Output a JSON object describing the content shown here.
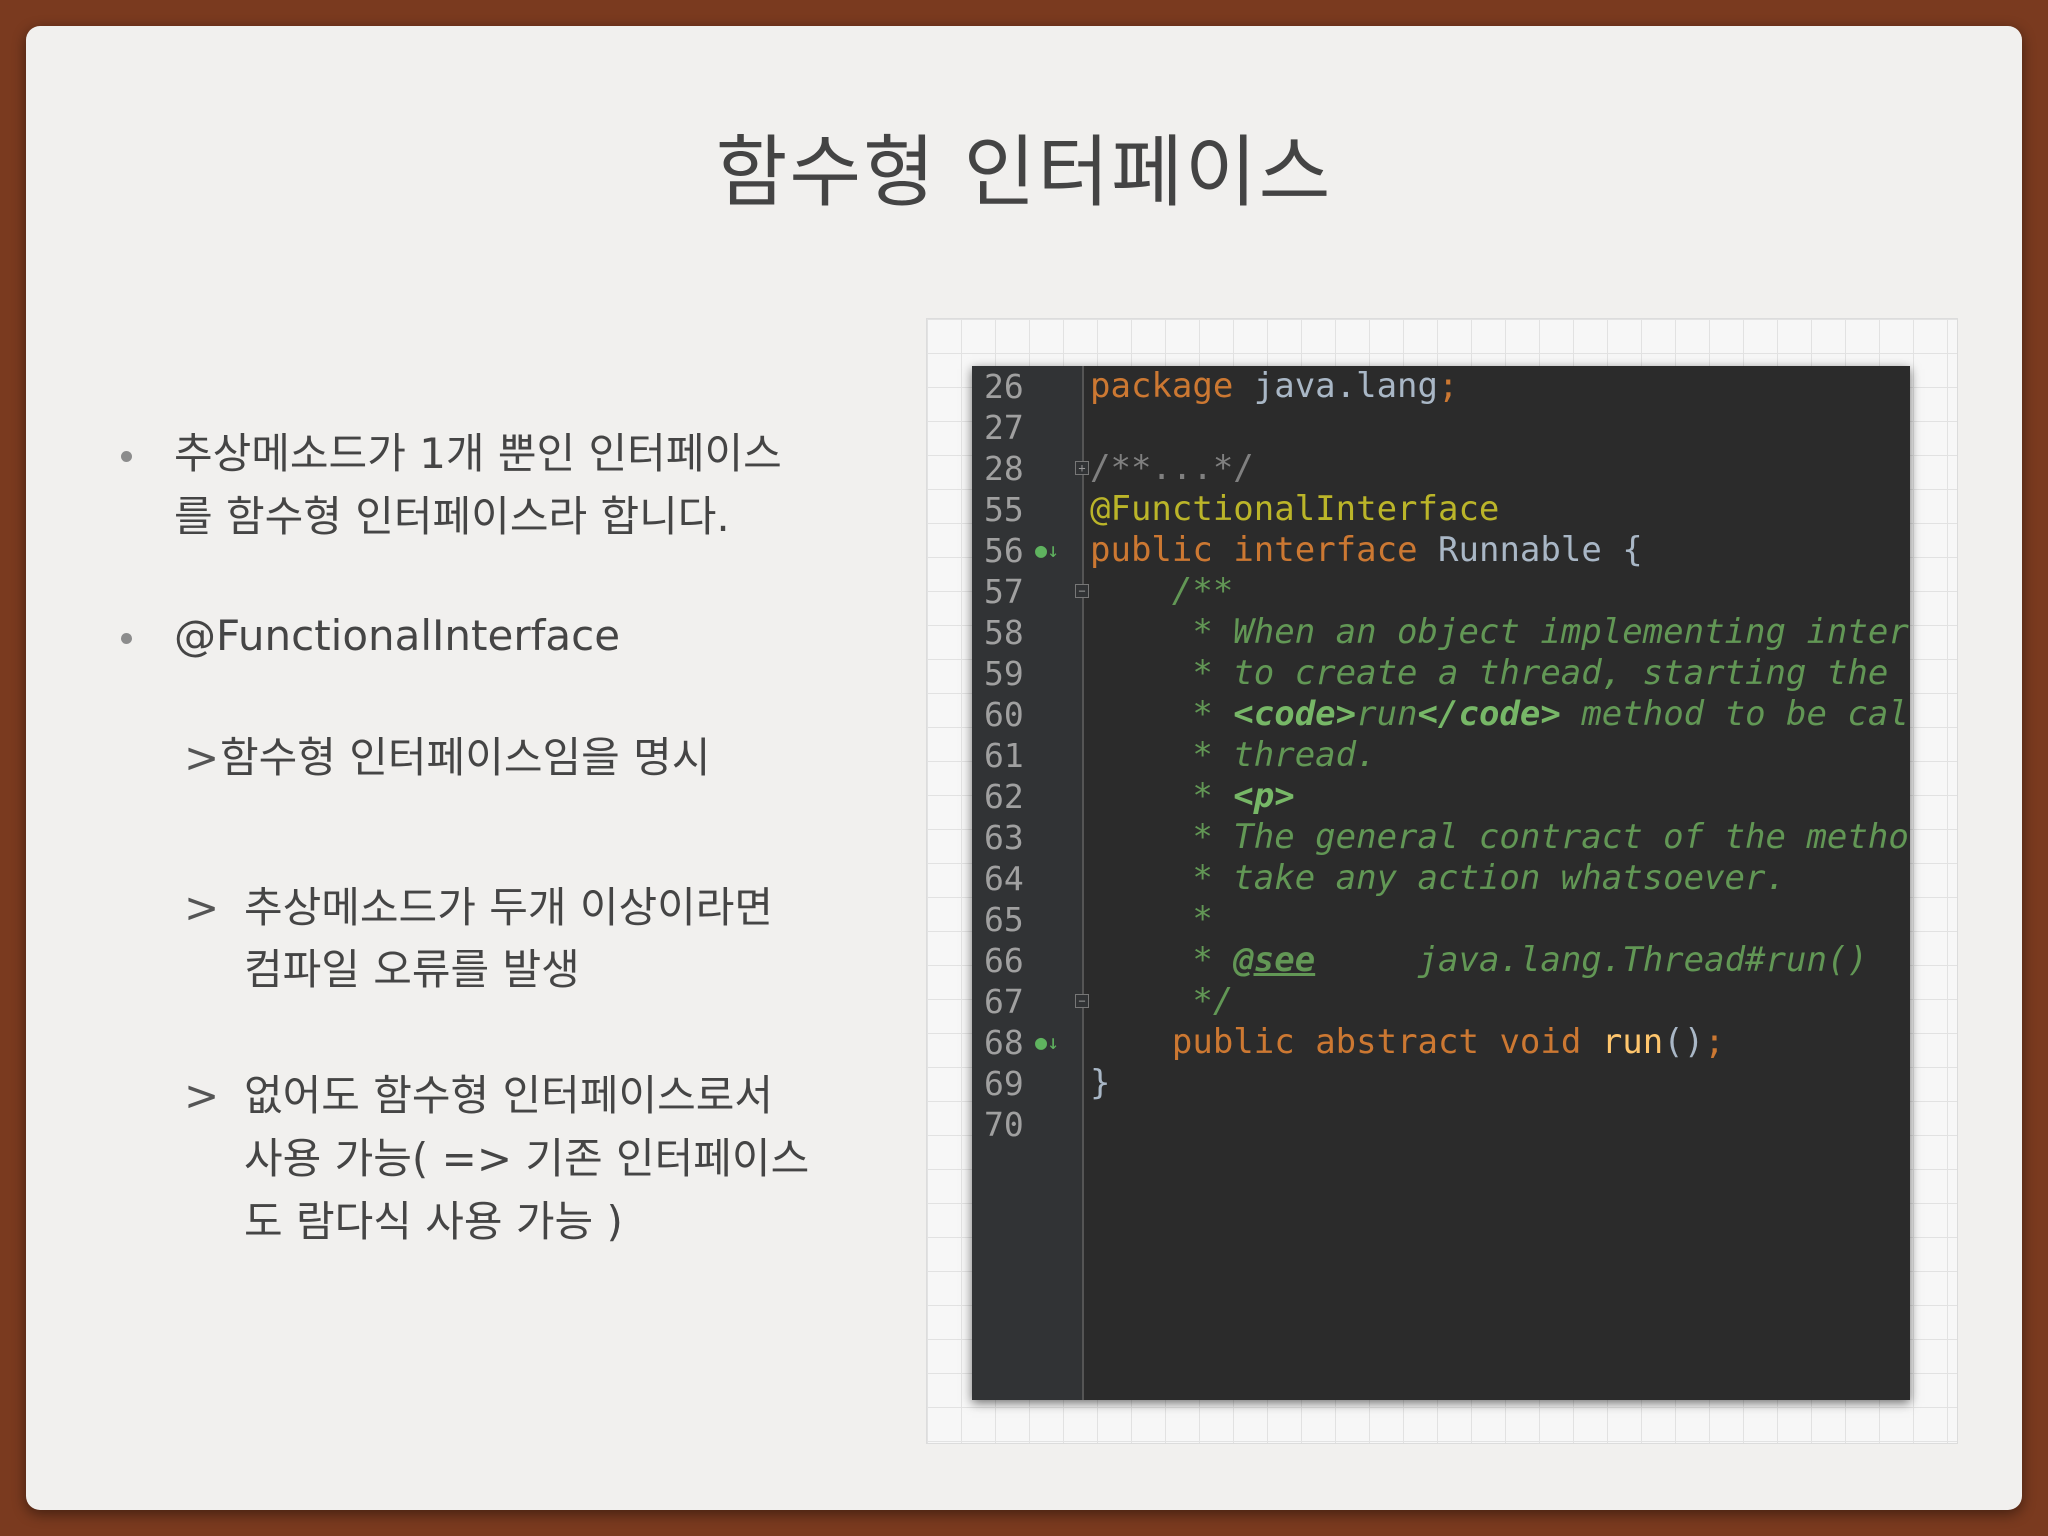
{
  "title": "함수형 인터페이스",
  "bullets": [
    {
      "lines": [
        "추상메소드가 1개 뿐인 인터페이스",
        "를 함수형 인터페이스라 합니다."
      ]
    },
    {
      "lines": [
        "@FunctionalInterface"
      ]
    }
  ],
  "sub_items": [
    {
      "marker": ">",
      "lines": [
        "함수형 인터페이스임을 명시"
      ]
    },
    {
      "marker": ">",
      "lines": [
        "추상메소드가 두개 이상이라면",
        "컴파일 오류를 발생"
      ]
    },
    {
      "marker": ">",
      "lines": [
        "없어도 함수형 인터페이스로서",
        "사용 가능( => 기존 인터페이스",
        "도 람다식 사용 가능 )"
      ]
    }
  ],
  "code": {
    "line_numbers": [
      "26",
      "27",
      "28",
      "55",
      "56",
      "57",
      "58",
      "59",
      "60",
      "61",
      "62",
      "63",
      "64",
      "65",
      "66",
      "67",
      "68",
      "69",
      "70"
    ],
    "lines": {
      "l26": {
        "kw": "package",
        "rest": " java.lang",
        "semi": ";"
      },
      "l28": "/**...*/",
      "l55": "@FunctionalInterface",
      "l56": {
        "kw1": "public",
        "kw2": "interface",
        "name": "Runnable",
        "brace": "{"
      },
      "l57": "    /**",
      "l58": "     * When an object implementing interfa",
      "l59": "     * to create a thread, starting the th",
      "l60": {
        "pre": "     * ",
        "tag1": "<code>",
        "mid": "run",
        "tag2": "</code>",
        "post": " method to be calle"
      },
      "l61": "     * thread.",
      "l62": {
        "pre": "     * ",
        "tag": "<p>"
      },
      "l63": "     * The general contract of the method",
      "l64": "     * take any action whatsoever.",
      "l65": "     *",
      "l66": {
        "pre": "     * ",
        "see": "@see",
        "post": "     java.lang.Thread#run()"
      },
      "l67": "     */",
      "l68": {
        "indent": "    ",
        "kw1": "public",
        "kw2": "abstract",
        "kw3": "void",
        "fn": "run",
        "rest": "()",
        "semi": ";"
      },
      "l69": "}"
    }
  }
}
